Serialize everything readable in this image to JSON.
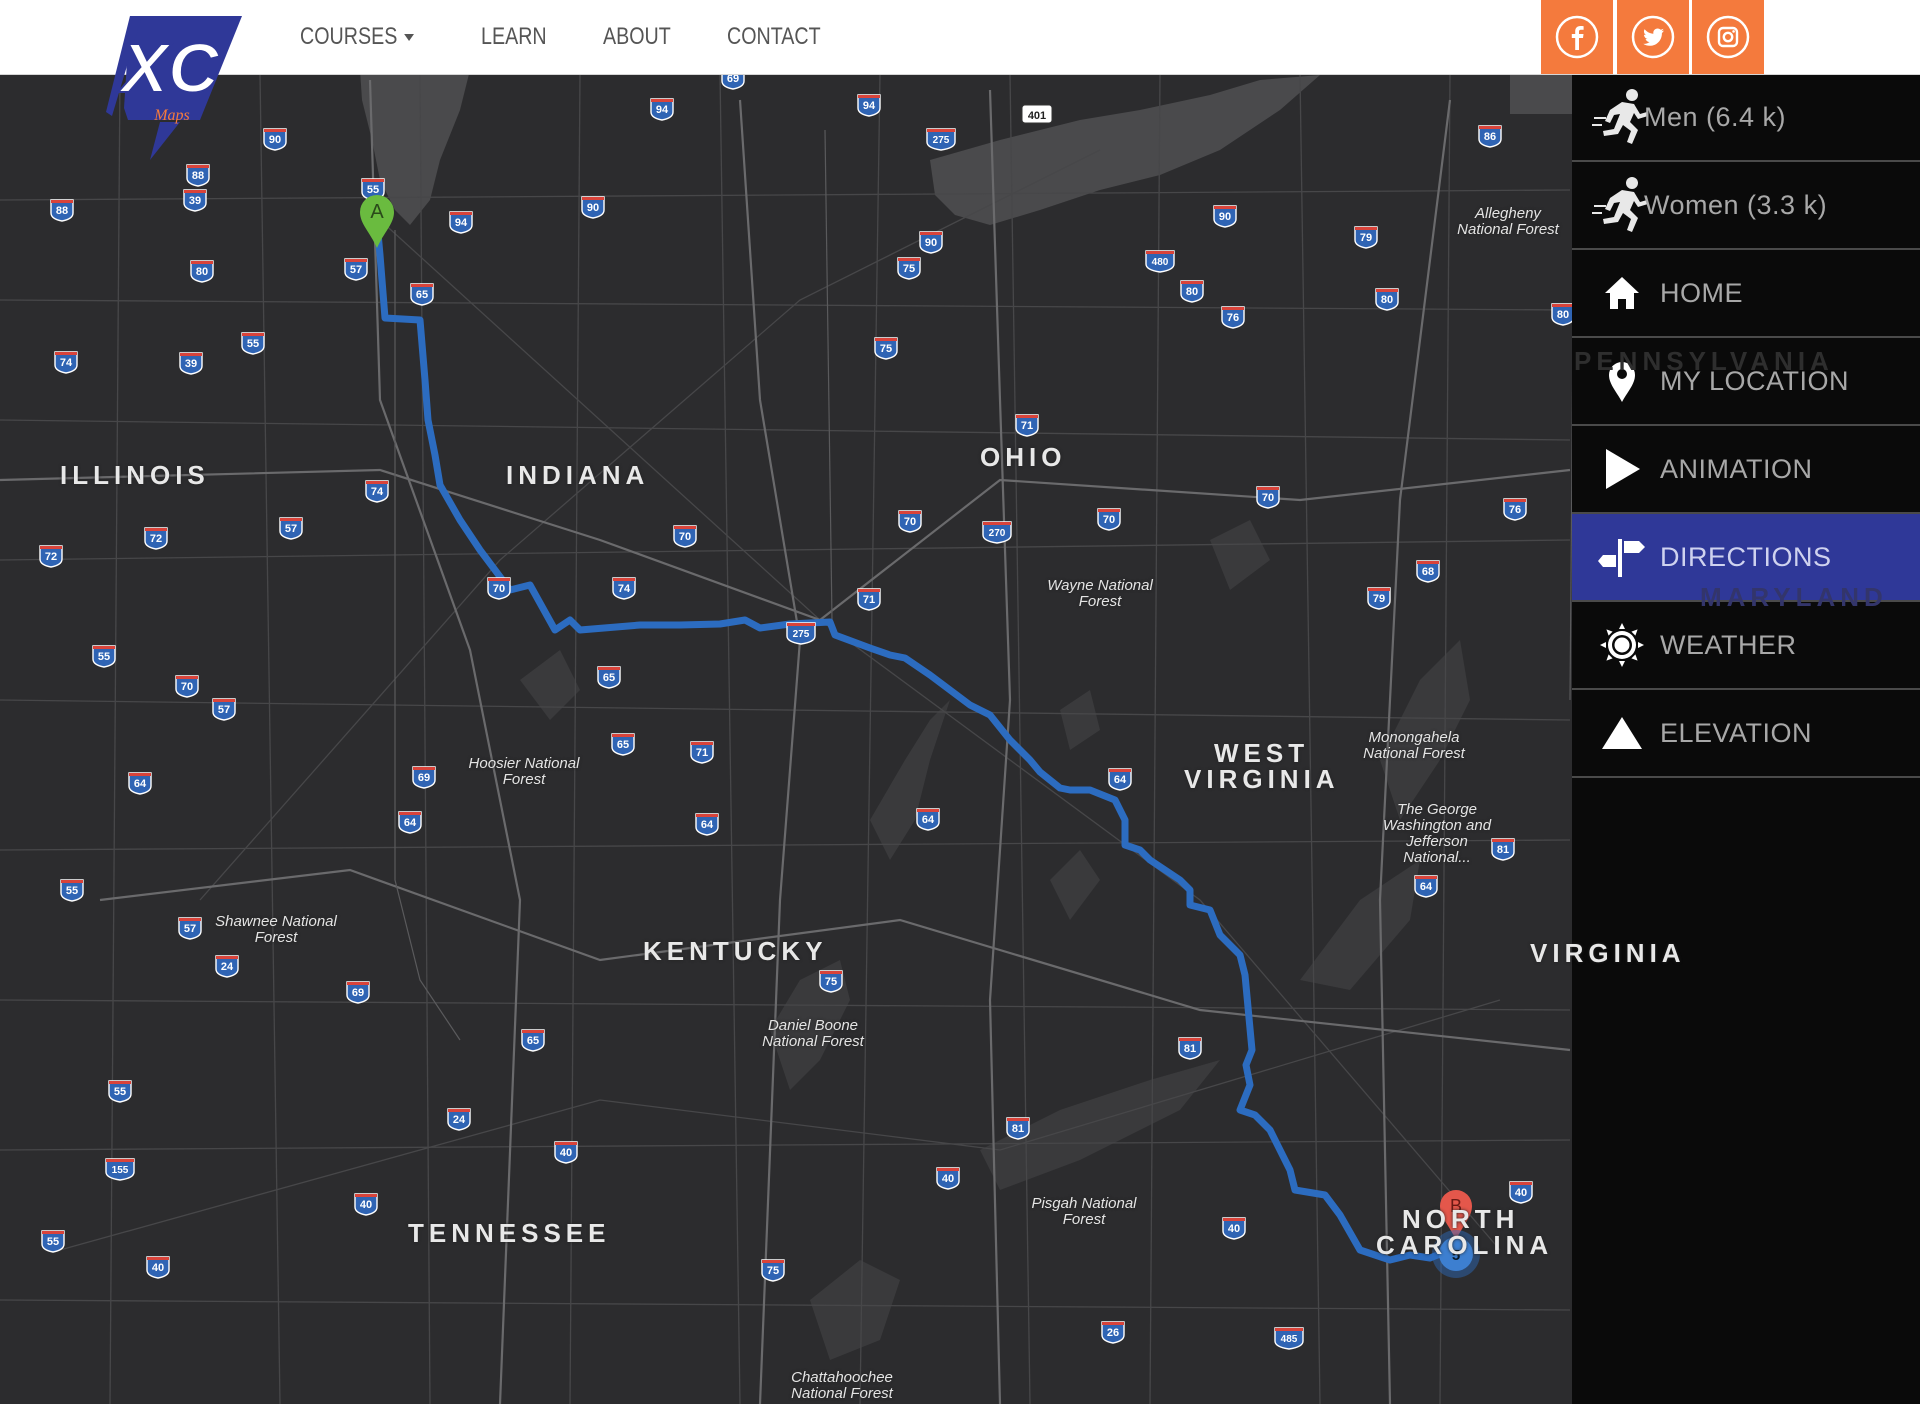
{
  "brand": {
    "logo_text": "XC",
    "logo_sub": "Maps"
  },
  "nav": {
    "items": [
      {
        "label": "COURSES",
        "dropdown": true
      },
      {
        "label": "LEARN"
      },
      {
        "label": "ABOUT"
      },
      {
        "label": "CONTACT"
      }
    ]
  },
  "social": [
    {
      "name": "facebook-icon",
      "glyph": "f"
    },
    {
      "name": "twitter-icon",
      "glyph": "t"
    },
    {
      "name": "instagram-icon",
      "glyph": "i"
    }
  ],
  "colors": {
    "accent_orange": "#f47a3d",
    "brand_blue": "#2f3898",
    "route_blue": "#2c6cc0",
    "map_bg": "#2c2c2e"
  },
  "sidebar": {
    "items": [
      {
        "label": "Men (6.4 k)",
        "icon": "runner-icon"
      },
      {
        "label": "Women (3.3 k)",
        "icon": "runner-icon"
      },
      {
        "label": "HOME",
        "icon": "home-icon"
      },
      {
        "label": "MY LOCATION",
        "icon": "location-pin-icon"
      },
      {
        "label": "ANIMATION",
        "icon": "play-icon"
      },
      {
        "label": "DIRECTIONS",
        "icon": "signpost-icon",
        "active": true
      },
      {
        "label": "WEATHER",
        "icon": "sun-icon"
      },
      {
        "label": "ELEVATION",
        "icon": "mountain-icon"
      }
    ]
  },
  "map": {
    "states": [
      "ILLINOIS",
      "INDIANA",
      "OHIO",
      "WEST",
      "VIRGINIA",
      "KENTUCKY",
      "TENNESSEE",
      "NORTH",
      "CAROLINA",
      "PENNSYLVANIA",
      "MARYLAND",
      "VIRGINIA"
    ],
    "forests": [
      "Allegheny National Forest",
      "Wayne National Forest",
      "Monongahela National Forest",
      "The George Washington and Jefferson National...",
      "Hoosier National Forest",
      "Shawnee National Forest",
      "Daniel Boone National Forest",
      "Pisgah National Forest",
      "Chattahoochee National Forest"
    ],
    "markers": {
      "start": "A",
      "end": "B",
      "cluster_count": "5"
    },
    "highway_shields": [
      "94",
      "90",
      "88",
      "39",
      "80",
      "74",
      "57",
      "65",
      "55",
      "70",
      "72",
      "69",
      "64",
      "24",
      "275",
      "71",
      "401",
      "86",
      "79",
      "76",
      "480",
      "75",
      "270",
      "68",
      "81",
      "26",
      "485",
      "40",
      "155"
    ]
  }
}
